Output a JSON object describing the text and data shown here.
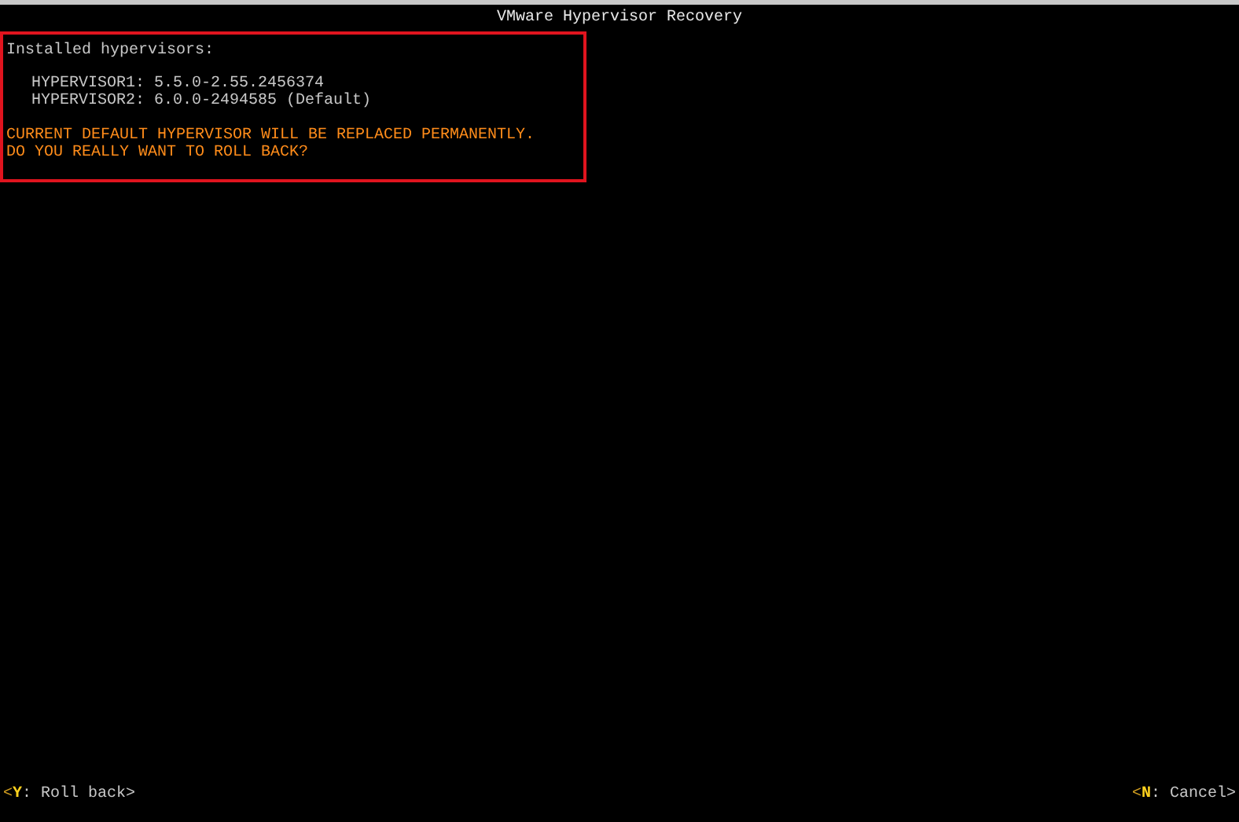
{
  "window": {
    "title": "VMware Hypervisor Recovery"
  },
  "heading": "Installed hypervisors:",
  "hypervisors": [
    {
      "text": "HYPERVISOR1: 5.5.0-2.55.2456374"
    },
    {
      "text": "HYPERVISOR2: 6.0.0-2494585 (Default)"
    }
  ],
  "warning": [
    "CURRENT DEFAULT HYPERVISOR WILL BE REPLACED PERMANENTLY.",
    "DO YOU REALLY WANT TO ROLL BACK?"
  ],
  "actions": [
    {
      "prefix": "<",
      "key": "Y",
      "suffix": ": Roll back>"
    },
    {
      "prefix": "<",
      "key": "N",
      "suffix": ": Cancel>"
    }
  ]
}
